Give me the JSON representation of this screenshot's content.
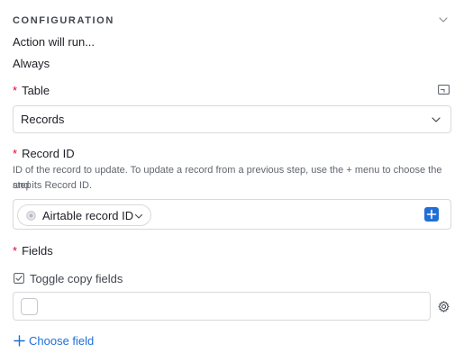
{
  "section": {
    "title": "CONFIGURATION"
  },
  "run": {
    "label": "Action will run...",
    "value": "Always"
  },
  "table": {
    "required_mark": "*",
    "label": "Table",
    "selected": "Records"
  },
  "record": {
    "required_mark": "*",
    "label": "Record ID",
    "help_line1": "ID of the record to update. To update a record from a previous step, use the + menu to choose the step",
    "help_line2": "and its Record ID.",
    "token_label": "Airtable record ID"
  },
  "fields": {
    "required_mark": "*",
    "label": "Fields",
    "toggle_label": "Toggle copy fields",
    "choose_field_label": "Choose field"
  },
  "colors": {
    "accent": "#1f6fd6",
    "required": "#dc0431"
  },
  "icons": [
    "chevron-down-icon",
    "layout-icon",
    "airtable-dot-icon",
    "plus-icon",
    "checkbox-checked-icon",
    "gear-icon"
  ]
}
